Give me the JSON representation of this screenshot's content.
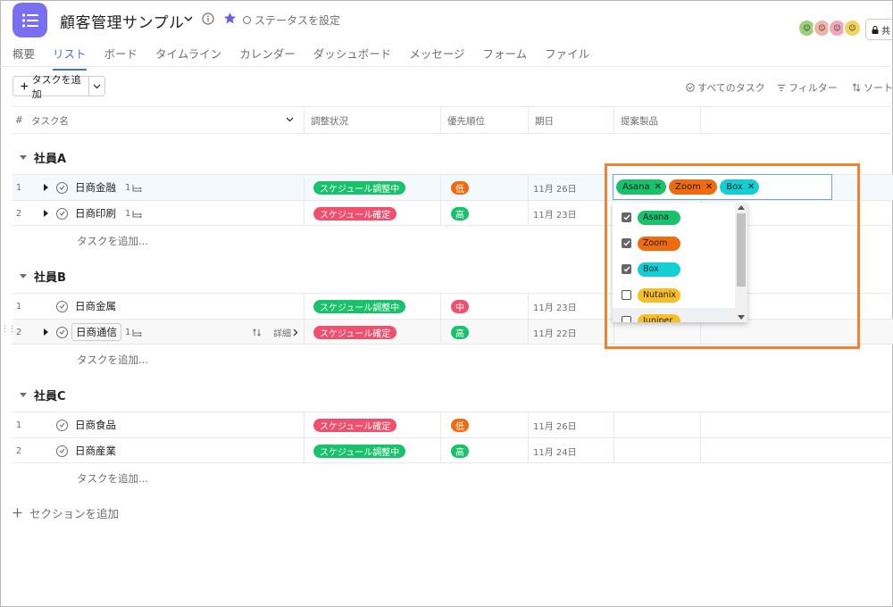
{
  "header": {
    "title": "顧客管理サンプル",
    "status_label": "ステータスを設定",
    "share_label": "共"
  },
  "tabs": [
    {
      "label": "概要",
      "active": false
    },
    {
      "label": "リスト",
      "active": true
    },
    {
      "label": "ボード",
      "active": false
    },
    {
      "label": "タイムライン",
      "active": false
    },
    {
      "label": "カレンダー",
      "active": false
    },
    {
      "label": "ダッシュボード",
      "active": false
    },
    {
      "label": "メッセージ",
      "active": false
    },
    {
      "label": "フォーム",
      "active": false
    },
    {
      "label": "ファイル",
      "active": false
    }
  ],
  "toolbar": {
    "add_task_label": "タスクを追加",
    "all_tasks_label": "すべてのタスク",
    "filter_label": "フィルター",
    "sort_label": "ソート"
  },
  "columns": {
    "number": "#",
    "task_name": "タスク名",
    "status": "調整状況",
    "priority": "優先順位",
    "due_date": "期日",
    "product": "提案製品"
  },
  "sections": [
    {
      "name": "社員A",
      "add_task_label": "タスクを追加...",
      "rows": [
        {
          "num": "1",
          "name": "日商金融",
          "subtasks": "1",
          "status": "スケジュール調整中",
          "priority": "低",
          "date": "11月 26日"
        },
        {
          "num": "2",
          "name": "日商印刷",
          "subtasks": "1",
          "status": "スケジュール確定",
          "priority": "高",
          "date": "11月 23日"
        }
      ]
    },
    {
      "name": "社員B",
      "add_task_label": "タスクを追加...",
      "rows": [
        {
          "num": "1",
          "name": "日商金属",
          "subtasks": "",
          "status": "スケジュール調整中",
          "priority": "中",
          "date": "11月 23日"
        },
        {
          "num": "2",
          "name": "日商通信",
          "subtasks": "1",
          "status": "スケジュール確定",
          "priority": "高",
          "date": "11月 22日",
          "detail": "詳細"
        }
      ]
    },
    {
      "name": "社員C",
      "add_task_label": "タスクを追加...",
      "rows": [
        {
          "num": "1",
          "name": "日商食品",
          "subtasks": "",
          "status": "スケジュール確定",
          "priority": "低",
          "date": "11月 26日"
        },
        {
          "num": "2",
          "name": "日商産業",
          "subtasks": "",
          "status": "スケジュール調整中",
          "priority": "高",
          "date": "11月 24日"
        }
      ]
    }
  ],
  "add_section_label": "セクションを追加",
  "product_dropdown": {
    "selected": [
      "Asana",
      "Zoom",
      "Box"
    ],
    "options": [
      {
        "label": "Asana",
        "checked": true
      },
      {
        "label": "Zoom",
        "checked": true
      },
      {
        "label": "Box",
        "checked": true
      },
      {
        "label": "Nutanix",
        "checked": false
      },
      {
        "label": "Juniper",
        "checked": false
      }
    ]
  },
  "colors": {
    "accent": "#4573d2",
    "app_icon": "#7a6ff0",
    "status_adjusting": "#19c16b",
    "status_confirmed": "#f0506e",
    "priority_low": "#f06a0f",
    "priority_mid": "#f0506e",
    "priority_high": "#19c16b",
    "annotation": "#f08232"
  }
}
